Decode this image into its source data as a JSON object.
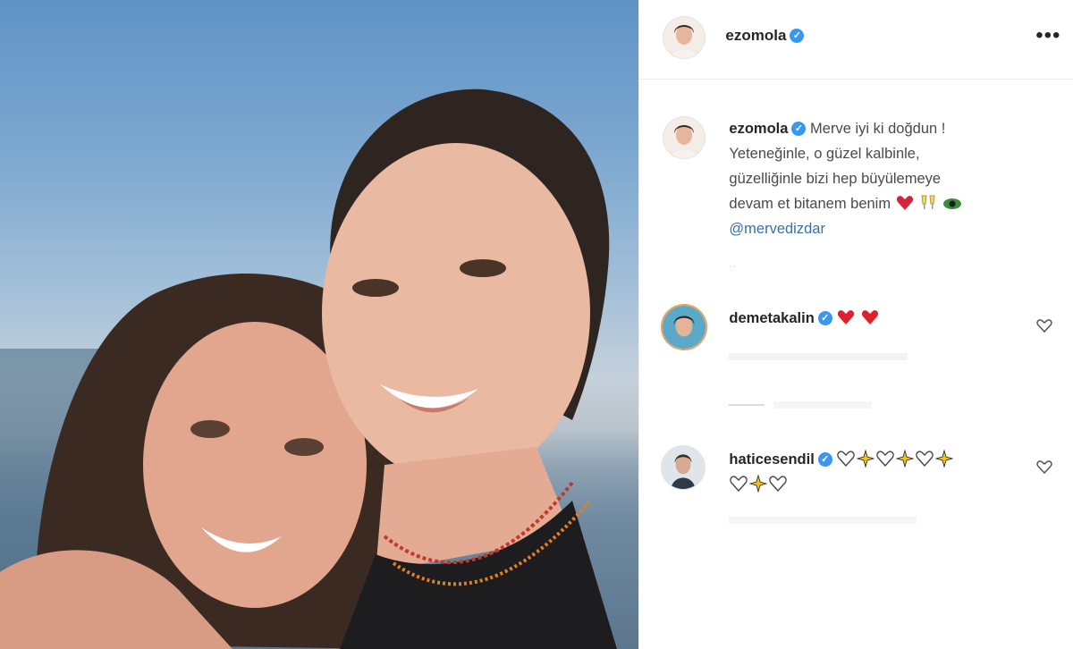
{
  "post": {
    "author": "ezomola",
    "verified_mark": "✓",
    "more_label": "•••"
  },
  "caption": {
    "author": "ezomola",
    "line1": "Merve iyi ki doğdun !",
    "line2": "Yeteneğinle, o güzel kalbinle,",
    "line3": "güzelliğinle bizi hep büyülemeye",
    "line4": "devam et bitanem benim",
    "mention": "@mervedizdar",
    "emojis": [
      "heart-icon",
      "clinking-glasses-icon",
      "eye-icon"
    ]
  },
  "comments": [
    {
      "username": "demetakalin",
      "emojis": [
        "red-heart-icon",
        "red-heart-icon"
      ]
    },
    {
      "username": "haticesendil",
      "emojis": [
        "white-heart-icon",
        "sparkles-icon",
        "white-heart-icon",
        "sparkles-icon",
        "white-heart-icon",
        "sparkles-icon",
        "white-heart-icon",
        "sparkles-icon",
        "white-heart-icon"
      ]
    }
  ],
  "colors": {
    "verified_blue": "#3897f0",
    "mention_blue": "#3a6fa8",
    "text": "#262626"
  }
}
